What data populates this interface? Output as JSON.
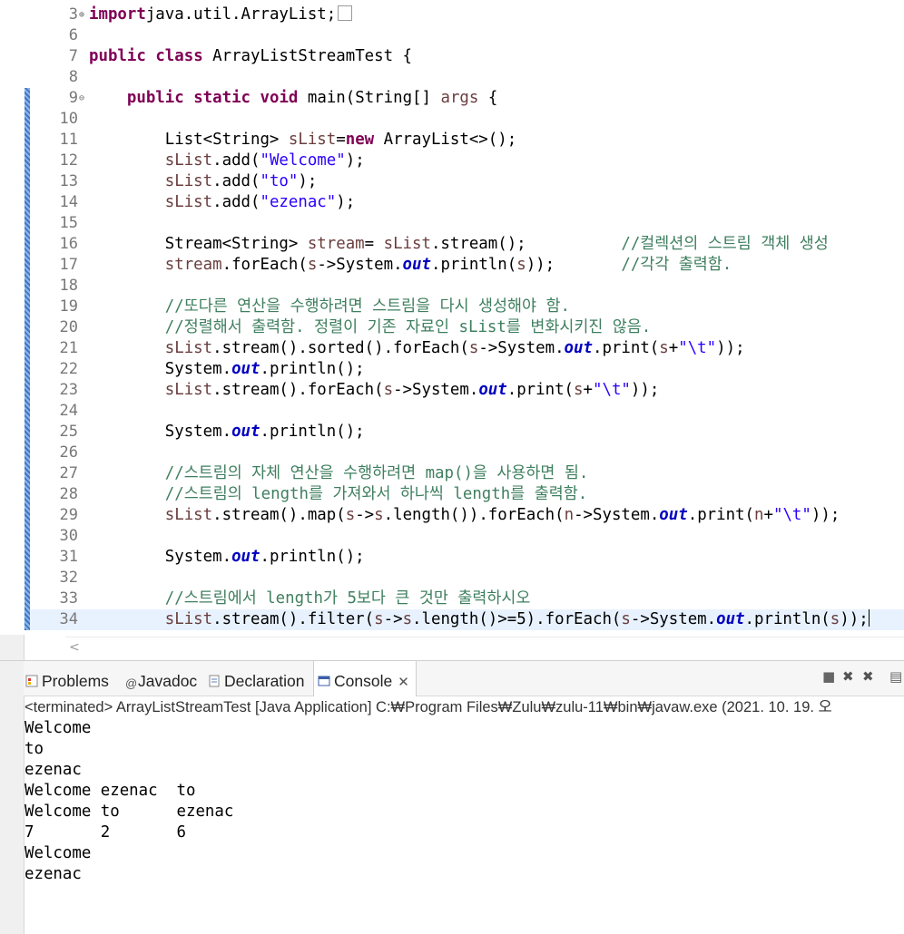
{
  "editor": {
    "lines": [
      {
        "n": "3",
        "fold": "⊕",
        "cur": false,
        "mark": false,
        "tokens": [
          [
            "kw",
            "import"
          ],
          [
            "",
            "java.util.ArrayList;"
          ]
        ],
        "box": true
      },
      {
        "n": "6",
        "tokens": []
      },
      {
        "n": "7",
        "tokens": [
          [
            "kw",
            "public"
          ],
          [
            "",
            " "
          ],
          [
            "kw",
            "class"
          ],
          [
            "",
            " ArrayListStreamTest {"
          ]
        ]
      },
      {
        "n": "8",
        "tokens": []
      },
      {
        "n": "9",
        "fold": "⊖",
        "mark": true,
        "tokens": [
          [
            "",
            "    "
          ],
          [
            "kw",
            "public"
          ],
          [
            "",
            " "
          ],
          [
            "kw",
            "static"
          ],
          [
            "",
            " "
          ],
          [
            "kw",
            "void"
          ],
          [
            "",
            " main(String[] "
          ],
          [
            "lv",
            "args"
          ],
          [
            "",
            " {"
          ]
        ]
      },
      {
        "n": "10",
        "mark": true,
        "tokens": []
      },
      {
        "n": "11",
        "mark": true,
        "tokens": [
          [
            "",
            "        List<String> "
          ],
          [
            "lv",
            "sList"
          ],
          [
            "",
            "="
          ],
          [
            "kw",
            "new"
          ],
          [
            "",
            " ArrayList<>();"
          ]
        ]
      },
      {
        "n": "12",
        "mark": true,
        "tokens": [
          [
            "",
            "        "
          ],
          [
            "lv",
            "sList"
          ],
          [
            "",
            ".add("
          ],
          [
            "str",
            "\"Welcome\""
          ],
          [
            "",
            ");"
          ]
        ]
      },
      {
        "n": "13",
        "mark": true,
        "tokens": [
          [
            "",
            "        "
          ],
          [
            "lv",
            "sList"
          ],
          [
            "",
            ".add("
          ],
          [
            "str",
            "\"to\""
          ],
          [
            "",
            ");"
          ]
        ]
      },
      {
        "n": "14",
        "mark": true,
        "tokens": [
          [
            "",
            "        "
          ],
          [
            "lv",
            "sList"
          ],
          [
            "",
            ".add("
          ],
          [
            "str",
            "\"ezenac\""
          ],
          [
            "",
            ");"
          ]
        ]
      },
      {
        "n": "15",
        "mark": true,
        "tokens": []
      },
      {
        "n": "16",
        "mark": true,
        "tokens": [
          [
            "",
            "        Stream<String> "
          ],
          [
            "lv",
            "stream"
          ],
          [
            "",
            "= "
          ],
          [
            "lv",
            "sList"
          ],
          [
            "",
            ".stream();          "
          ],
          [
            "cmt",
            "//컬렉션의 스트림 객체 생성"
          ]
        ]
      },
      {
        "n": "17",
        "mark": true,
        "tokens": [
          [
            "",
            "        "
          ],
          [
            "lv",
            "stream"
          ],
          [
            "",
            ".forEach("
          ],
          [
            "lv",
            "s"
          ],
          [
            "",
            "->System."
          ],
          [
            "fld",
            "out"
          ],
          [
            "",
            ".println("
          ],
          [
            "lv",
            "s"
          ],
          [
            "",
            "));       "
          ],
          [
            "cmt",
            "//각각 출력함."
          ]
        ]
      },
      {
        "n": "18",
        "mark": true,
        "tokens": []
      },
      {
        "n": "19",
        "mark": true,
        "tokens": [
          [
            "",
            "        "
          ],
          [
            "cmt",
            "//또다른 연산을 수행하려면 스트림을 다시 생성해야 함."
          ]
        ]
      },
      {
        "n": "20",
        "mark": true,
        "tokens": [
          [
            "",
            "        "
          ],
          [
            "cmt",
            "//정렬해서 출력함. 정렬이 기존 자료인 sList를 변화시키진 않음."
          ]
        ]
      },
      {
        "n": "21",
        "mark": true,
        "tokens": [
          [
            "",
            "        "
          ],
          [
            "lv",
            "sList"
          ],
          [
            "",
            ".stream().sorted().forEach("
          ],
          [
            "lv",
            "s"
          ],
          [
            "",
            "->System."
          ],
          [
            "fld",
            "out"
          ],
          [
            "",
            ".print("
          ],
          [
            "lv",
            "s"
          ],
          [
            "",
            "+"
          ],
          [
            "str",
            "\"\\t\""
          ],
          [
            "",
            "));"
          ]
        ]
      },
      {
        "n": "22",
        "mark": true,
        "tokens": [
          [
            "",
            "        System."
          ],
          [
            "fld",
            "out"
          ],
          [
            "",
            ".println();"
          ]
        ]
      },
      {
        "n": "23",
        "mark": true,
        "tokens": [
          [
            "",
            "        "
          ],
          [
            "lv",
            "sList"
          ],
          [
            "",
            ".stream().forEach("
          ],
          [
            "lv",
            "s"
          ],
          [
            "",
            "->System."
          ],
          [
            "fld",
            "out"
          ],
          [
            "",
            ".print("
          ],
          [
            "lv",
            "s"
          ],
          [
            "",
            "+"
          ],
          [
            "str",
            "\"\\t\""
          ],
          [
            "",
            "));"
          ]
        ]
      },
      {
        "n": "24",
        "mark": true,
        "tokens": []
      },
      {
        "n": "25",
        "mark": true,
        "tokens": [
          [
            "",
            "        System."
          ],
          [
            "fld",
            "out"
          ],
          [
            "",
            ".println();"
          ]
        ]
      },
      {
        "n": "26",
        "mark": true,
        "tokens": []
      },
      {
        "n": "27",
        "mark": true,
        "tokens": [
          [
            "",
            "        "
          ],
          [
            "cmt",
            "//스트림의 자체 연산을 수행하려면 map()을 사용하면 됨."
          ]
        ]
      },
      {
        "n": "28",
        "mark": true,
        "tokens": [
          [
            "",
            "        "
          ],
          [
            "cmt",
            "//스트림의 length를 가져와서 하나씩 length를 출력함."
          ]
        ]
      },
      {
        "n": "29",
        "mark": true,
        "tokens": [
          [
            "",
            "        "
          ],
          [
            "lv",
            "sList"
          ],
          [
            "",
            ".stream().map("
          ],
          [
            "lv",
            "s"
          ],
          [
            "",
            "->"
          ],
          [
            "lv",
            "s"
          ],
          [
            "",
            ".length()).forEach("
          ],
          [
            "lv",
            "n"
          ],
          [
            "",
            "->System."
          ],
          [
            "fld",
            "out"
          ],
          [
            "",
            ".print("
          ],
          [
            "lv",
            "n"
          ],
          [
            "",
            "+"
          ],
          [
            "str",
            "\"\\t\""
          ],
          [
            "",
            "));"
          ]
        ]
      },
      {
        "n": "30",
        "mark": true,
        "tokens": []
      },
      {
        "n": "31",
        "mark": true,
        "tokens": [
          [
            "",
            "        System."
          ],
          [
            "fld",
            "out"
          ],
          [
            "",
            ".println();"
          ]
        ]
      },
      {
        "n": "32",
        "mark": true,
        "tokens": []
      },
      {
        "n": "33",
        "mark": true,
        "tokens": [
          [
            "",
            "        "
          ],
          [
            "cmt",
            "//스트림에서 length가 5보다 큰 것만 출력하시오"
          ]
        ]
      },
      {
        "n": "34",
        "mark": true,
        "cur": true,
        "caret": true,
        "tokens": [
          [
            "",
            "        "
          ],
          [
            "lv",
            "sList"
          ],
          [
            "",
            ".stream().filter("
          ],
          [
            "lv",
            "s"
          ],
          [
            "",
            "->"
          ],
          [
            "lv",
            "s"
          ],
          [
            "",
            ".length()>=5).forEach("
          ],
          [
            "lv",
            "s"
          ],
          [
            "",
            "->System."
          ],
          [
            "fld",
            "out"
          ],
          [
            "",
            ".println("
          ],
          [
            "lv",
            "s"
          ],
          [
            "",
            "));"
          ]
        ]
      }
    ]
  },
  "panel": {
    "tabs": [
      {
        "label": "Problems",
        "icon": "problems-icon",
        "active": false
      },
      {
        "label": "Javadoc",
        "icon": "javadoc-icon",
        "active": false
      },
      {
        "label": "Declaration",
        "icon": "declaration-icon",
        "active": false
      },
      {
        "label": "Console",
        "icon": "console-icon",
        "active": true
      }
    ],
    "console_description": "<terminated> ArrayListStreamTest [Java Application] C:₩Program Files₩Zulu₩zulu-11₩bin₩javaw.exe  (2021. 10. 19. 오",
    "console_output": [
      "Welcome",
      "to",
      "ezenac",
      "Welcome ezenac  to",
      "Welcome to      ezenac",
      "7       2       6",
      "Welcome",
      "ezenac"
    ]
  }
}
